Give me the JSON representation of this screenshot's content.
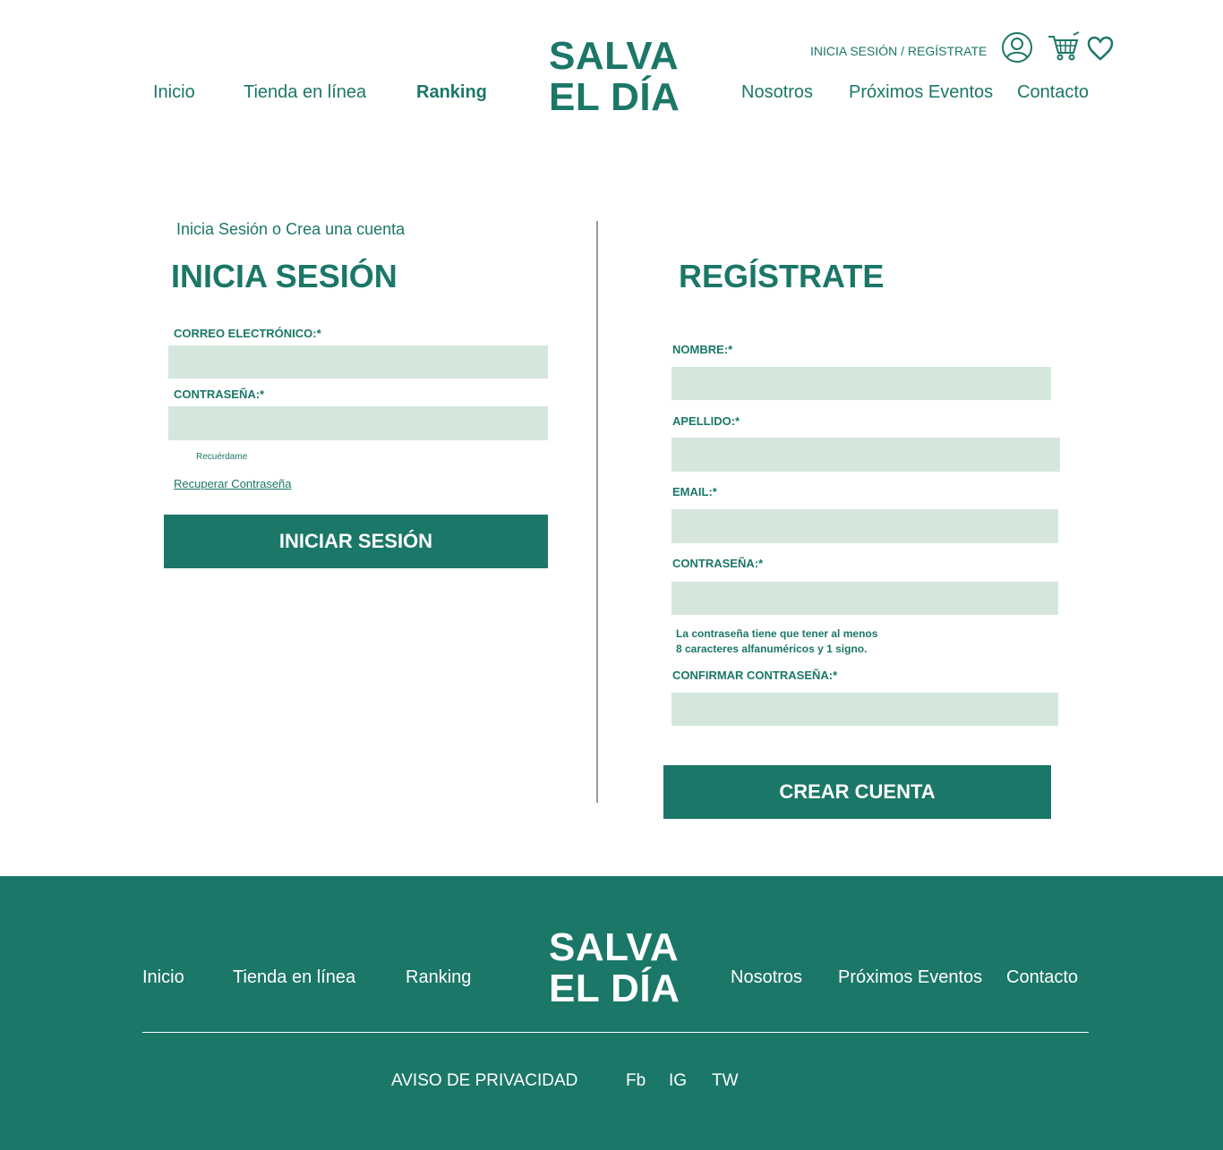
{
  "header": {
    "nav_left": [
      "Inicio",
      "Tienda en línea",
      "Ranking"
    ],
    "nav_right": [
      "Nosotros",
      "Próximos Eventos",
      "Contacto"
    ],
    "logo_line1": "SALVA",
    "logo_line2": "EL DÍA",
    "auth_link": "INICIA SESIÓN / REGÍSTRATE",
    "active_item": "Ranking",
    "icons": [
      "user-icon",
      "cart-icon",
      "heart-icon"
    ]
  },
  "login": {
    "breadcrumb": "Inicia Sesión o Crea una cuenta",
    "title": "INICIA SESIÓN",
    "email_label": "CORREO ELECTRÓNICO:*",
    "email_value": "",
    "password_label": "CONTRASEÑA:*",
    "password_value": "",
    "remember_label": "Recuérdame",
    "recover_link": "Recuperar Contraseña",
    "submit_label": "INICIAR SESIÓN"
  },
  "register": {
    "title": "REGÍSTRATE",
    "name_label": "NOMBRE:*",
    "lastname_label": "APELLIDO:*",
    "email_label": "EMAIL:*",
    "password_label": "CONTRASEÑA:*",
    "password_hint_line1": "La contraseña tiene que tener al menos",
    "password_hint_line2": "8 caracteres alfanuméricos y 1 signo.",
    "confirm_label": "CONFIRMAR CONTRASEÑA:*",
    "submit_label": "CREAR CUENTA"
  },
  "footer": {
    "nav_left": [
      "Inicio",
      "Tienda en línea",
      "Ranking"
    ],
    "nav_right": [
      "Nosotros",
      "Próximos Eventos",
      "Contacto"
    ],
    "logo_line1": "SALVA",
    "logo_line2": "EL DÍA",
    "privacy": "AVISO DE PRIVACIDAD",
    "social": [
      "Fb",
      "IG",
      "TW"
    ]
  },
  "colors": {
    "brand": "#1b7768",
    "input_bg": "#d5e7dd",
    "divider": "#9a9a9a",
    "text_on_brand": "#ffffff"
  }
}
